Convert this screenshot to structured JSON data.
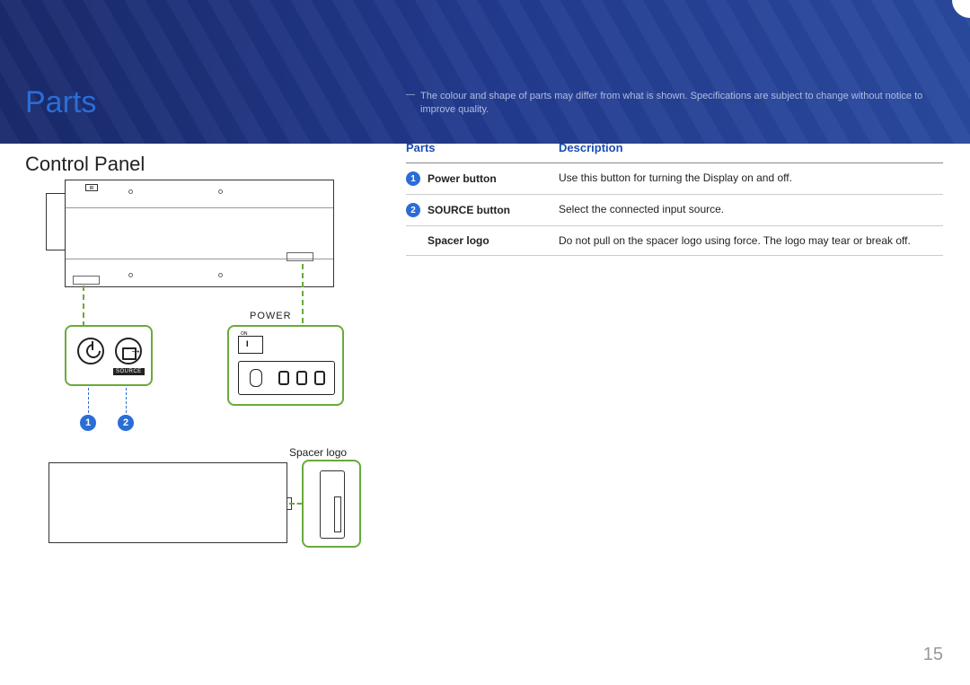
{
  "page": {
    "title": "Parts",
    "section": "Control Panel",
    "note_dash": "―",
    "note": "The colour and shape of parts may differ from what is shown. Specifications are subject to change without notice to improve quality.",
    "page_number": "15"
  },
  "diagram": {
    "power_label": "POWER",
    "source_label": "SOURCE",
    "spacer_label": "Spacer logo",
    "ir_label": "IR",
    "badge1": "1",
    "badge2": "2",
    "switch_on": "ON",
    "switch_i": "I"
  },
  "table": {
    "header_parts": "Parts",
    "header_desc": "Description",
    "rows": [
      {
        "num": "1",
        "name": "Power button",
        "desc": "Use this button for turning the Display on and off."
      },
      {
        "num": "2",
        "name": "SOURCE button",
        "desc": "Select the connected input source."
      },
      {
        "num": "",
        "name": "Spacer logo",
        "desc": "Do not pull on the spacer logo using force. The logo may tear or break off."
      }
    ]
  }
}
